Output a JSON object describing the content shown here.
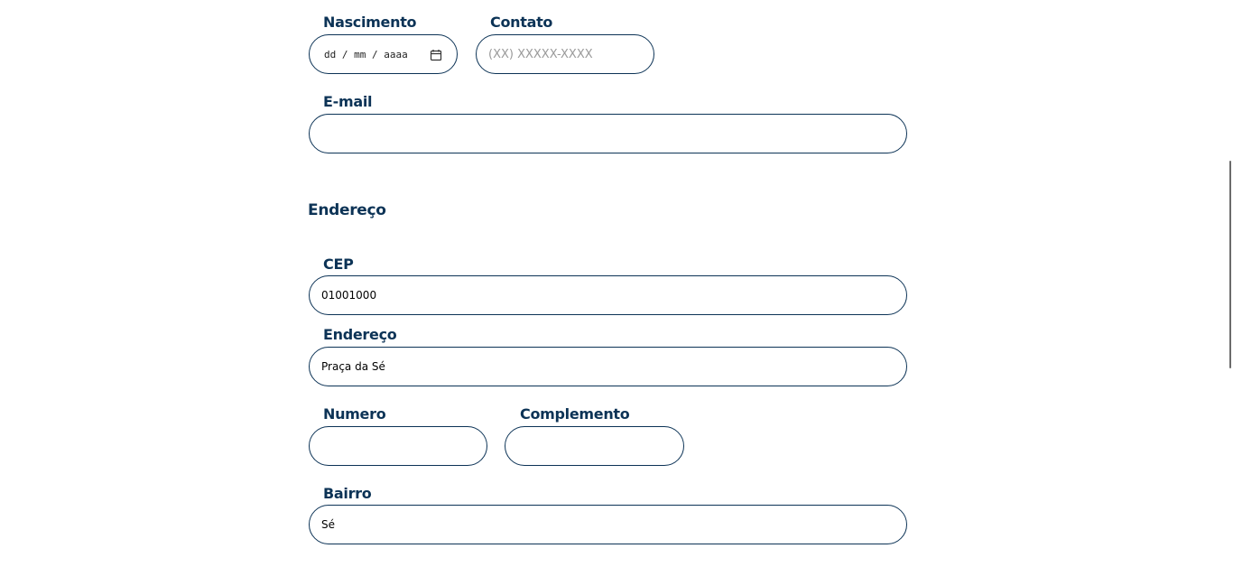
{
  "form": {
    "nascimento": {
      "label": "Nascimento",
      "placeholder": "dd / mm / aaaa"
    },
    "contato": {
      "label": "Contato",
      "placeholder": "(XX) XXXXX-XXXX",
      "value": ""
    },
    "email": {
      "label": "E-mail",
      "value": ""
    },
    "endereco_section": {
      "title": "Endereço"
    },
    "cep": {
      "label": "CEP",
      "value": "01001000"
    },
    "endereco": {
      "label": "Endereço",
      "value": "Praça da Sé"
    },
    "numero": {
      "label": "Numero",
      "value": ""
    },
    "complemento": {
      "label": "Complemento",
      "value": ""
    },
    "bairro": {
      "label": "Bairro",
      "value": "Sé"
    }
  },
  "icons": {
    "date_picker": "calendar-icon"
  },
  "colors": {
    "primary": "#0c3356",
    "placeholder": "#9a9a9a"
  }
}
